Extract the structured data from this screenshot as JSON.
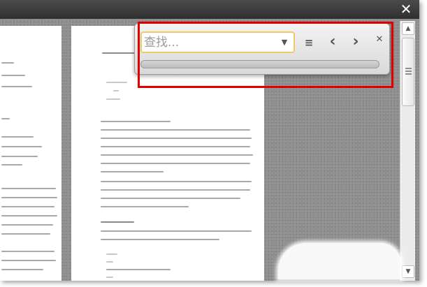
{
  "window": {
    "close_glyph": "✕"
  },
  "find_bar": {
    "placeholder": "查找...",
    "query": "",
    "dropdown_glyph": "▼",
    "buttons": {
      "options_glyph": "≡",
      "previous_glyph": "‹",
      "next_glyph": "›",
      "close_glyph": "✕"
    },
    "progress": 0,
    "highlight_color": "#e00000",
    "field_focus_color": "#f1c86a"
  },
  "scrollbar": {
    "up_glyph": "▲",
    "down_glyph": "▼"
  },
  "document": {
    "background_color": "#8f8f8f",
    "page_color": "#ffffff"
  }
}
